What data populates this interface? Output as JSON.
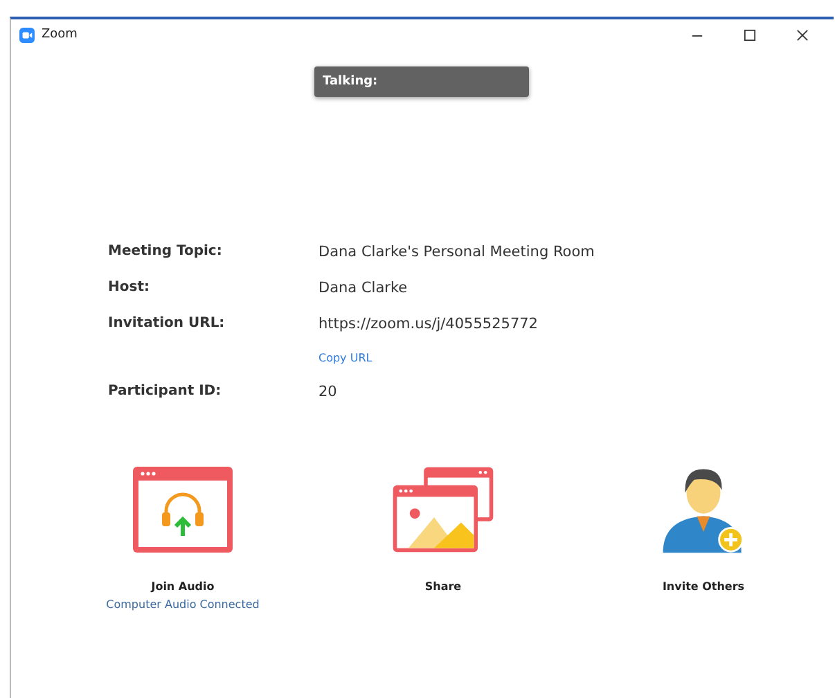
{
  "window": {
    "title": "Zoom"
  },
  "toast": {
    "label": "Talking:"
  },
  "details": [
    {
      "label": "Meeting Topic:",
      "value": "Dana Clarke's Personal Meeting Room"
    },
    {
      "label": "Host:",
      "value": "Dana Clarke"
    },
    {
      "label": "Invitation URL:",
      "value": "https://zoom.us/j/4055525772",
      "link": "Copy URL"
    },
    {
      "label": "Participant ID:",
      "value": "20"
    }
  ],
  "actions": [
    {
      "kind": "audio",
      "label": "Join Audio",
      "status": "Computer Audio Connected"
    },
    {
      "kind": "share",
      "label": "Share"
    },
    {
      "kind": "invite",
      "label": "Invite Others"
    }
  ]
}
